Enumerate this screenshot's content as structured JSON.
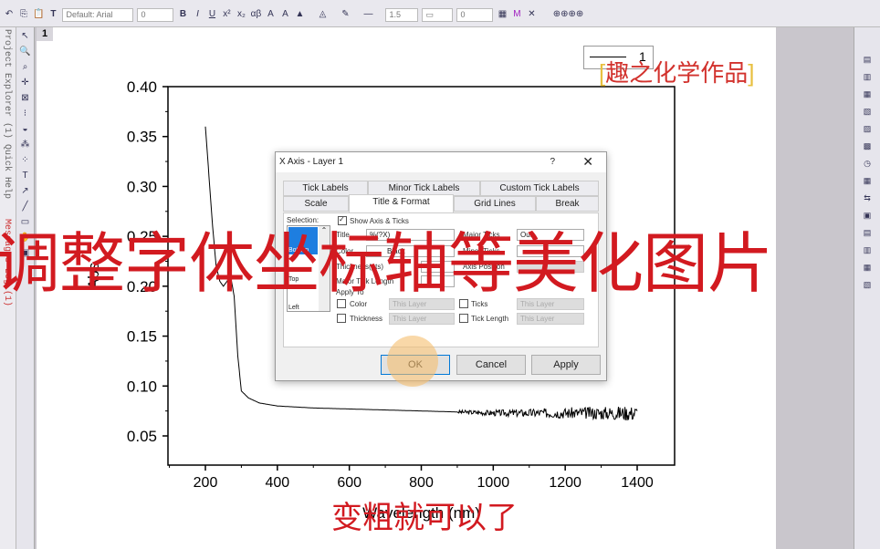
{
  "toolbar": {
    "font": "Default: Arial",
    "font_size": "0",
    "line_width": "1.5",
    "zero_field": "0",
    "buttons": [
      "B",
      "I",
      "U",
      "x²",
      "x₂",
      "αβ",
      "A",
      "A"
    ]
  },
  "left_tabs": [
    "Project Explorer (1)",
    "Quick Help",
    "Messages Log (1)"
  ],
  "page_tab": "1",
  "legend": {
    "label": "1"
  },
  "watermark": {
    "open": "[",
    "text": "趣之化学作品",
    "close": "]"
  },
  "chart_data": {
    "type": "line",
    "xlabel": "Wavelength (nm)",
    "ylabel": "Abs",
    "xlim": [
      100,
      1450
    ],
    "ylim": [
      0.02,
      0.4
    ],
    "xticks": [
      200,
      400,
      600,
      800,
      1000,
      1200,
      1400
    ],
    "yticks": [
      0.05,
      0.1,
      0.15,
      0.2,
      0.25,
      0.3,
      0.35,
      0.4
    ],
    "series": [
      {
        "name": "1",
        "x": [
          200,
          210,
          220,
          230,
          240,
          250,
          260,
          270,
          280,
          290,
          300,
          320,
          350,
          400,
          500,
          600,
          700,
          800,
          900,
          1000,
          1100,
          1200,
          1300,
          1400
        ],
        "y": [
          0.36,
          0.31,
          0.26,
          0.22,
          0.205,
          0.2,
          0.205,
          0.21,
          0.19,
          0.13,
          0.095,
          0.088,
          0.083,
          0.08,
          0.078,
          0.077,
          0.076,
          0.075,
          0.074,
          0.073,
          0.073,
          0.073,
          0.073,
          0.073
        ]
      }
    ],
    "line_color": "#000000",
    "grid": false
  },
  "dialog": {
    "title": "X Axis - Layer 1",
    "help": "?",
    "close": "✕",
    "tabs_row1": [
      "Tick Labels",
      "Minor Tick Labels",
      "Custom Tick Labels"
    ],
    "tabs_row2": [
      "Scale",
      "Title & Format",
      "Grid Lines",
      "Break"
    ],
    "active_tab": "Title & Format",
    "selection_label": "Selection:",
    "selection_items": [
      "Bottom",
      "Top",
      "Left"
    ],
    "show_axis": "Show Axis & Ticks",
    "title_label": "Title",
    "title_value": "%(?X)",
    "color_label": "Color",
    "color_value": "Black",
    "thickness_label": "Thickness(pts)",
    "major_tick_len_label": "Major Tick Length",
    "major_ticks_label": "Major Ticks",
    "major_ticks_value": "Out",
    "minor_ticks_label": "Minor Ticks",
    "axis_position_label": "Axis Position",
    "apply_to": "Apply To",
    "apply_rows": [
      {
        "label": "Color",
        "value": "This Layer"
      },
      {
        "label": "Ticks",
        "value": "This Layer"
      },
      {
        "label": "Thickness",
        "value": "This Layer"
      },
      {
        "label": "Tick Length",
        "value": "This Layer"
      }
    ],
    "ok": "OK",
    "cancel": "Cancel",
    "apply": "Apply"
  },
  "captions": {
    "main": "调整字体坐标轴等美化图片",
    "sub": "变粗就可以了"
  }
}
